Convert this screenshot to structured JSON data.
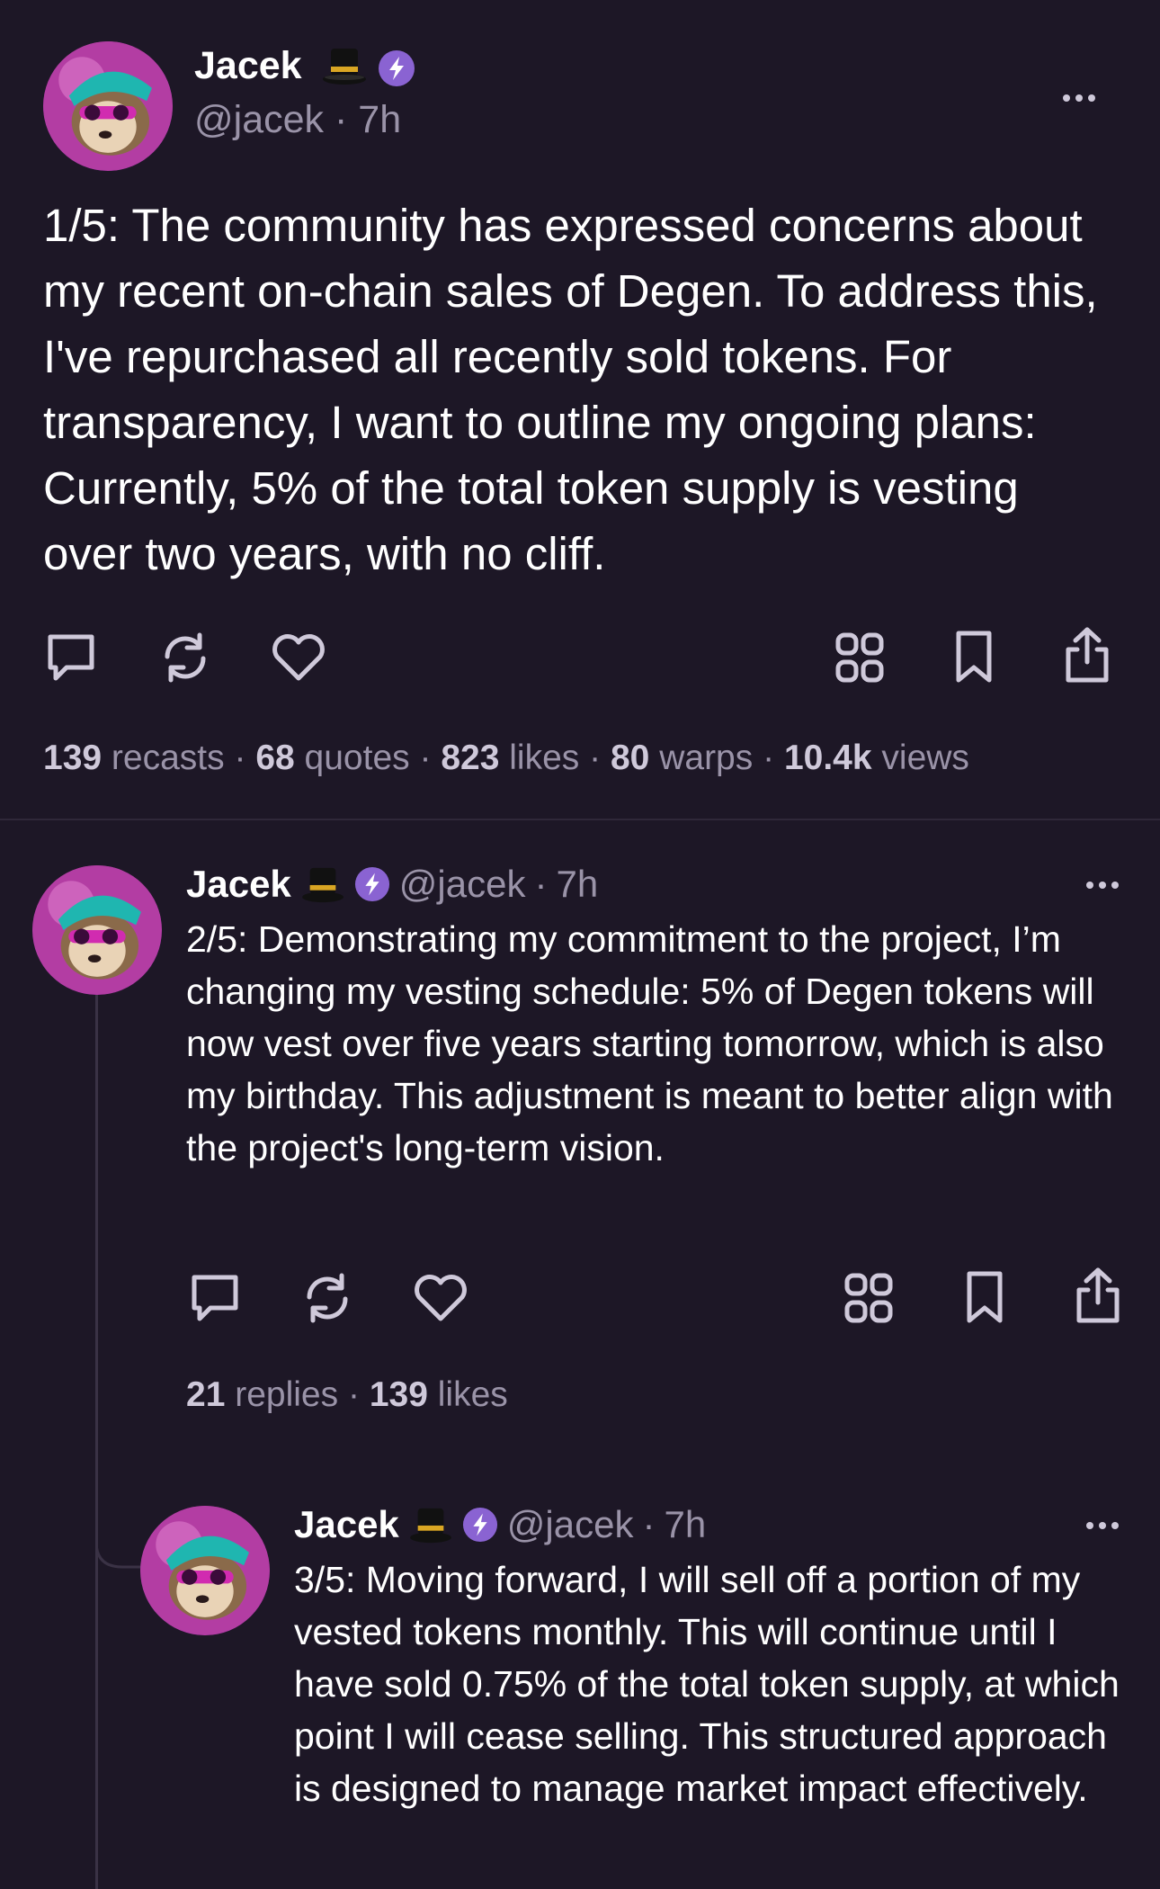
{
  "posts": [
    {
      "display_name": "Jacek",
      "handle": "@jacek",
      "separator": "·",
      "time": "7h",
      "text": "1/5: The community has expressed concerns about my recent on-chain sales of Degen. To address this, I've repurchased all recently sold tokens. For transparency, I want to outline my ongoing plans: Currently, 5% of the total token supply is vesting over two years, with no cliff.",
      "stats": [
        {
          "count": "139",
          "label": "recasts"
        },
        {
          "count": "68",
          "label": "quotes"
        },
        {
          "count": "823",
          "label": "likes"
        },
        {
          "count": "80",
          "label": "warps"
        },
        {
          "count": "10.4k",
          "label": "views"
        }
      ]
    },
    {
      "display_name": "Jacek",
      "handle": "@jacek",
      "separator": "·",
      "time": "7h",
      "text": "2/5: Demonstrating my commitment to the project, I’m changing my vesting schedule: 5% of Degen tokens will now vest over five years starting tomorrow, which is also my birthday. This adjustment is meant to better align with the project's long-term vision.",
      "stats": [
        {
          "count": "21",
          "label": "replies"
        },
        {
          "count": "139",
          "label": "likes"
        }
      ]
    },
    {
      "display_name": "Jacek",
      "handle": "@jacek",
      "separator": "·",
      "time": "7h",
      "text": "3/5: Moving forward, I will sell off a portion of my vested tokens monthly. This will continue until I have sold 0.75% of the total token supply, at which point I will cease selling. This structured approach is designed to manage market impact effectively."
    }
  ],
  "stat_separator": "·",
  "icons": {
    "name_badge": "top-hat-icon",
    "verified": "lightning-badge-icon",
    "reply": "comment-icon",
    "recast": "recast-icon",
    "like": "heart-icon",
    "apps": "grid-icon",
    "bookmark": "bookmark-icon",
    "share": "share-icon",
    "more": "more-dots-icon"
  },
  "colors": {
    "background": "#1d1726",
    "text": "#ffffff",
    "muted": "#9a93a8",
    "badge": "#8a63d2"
  }
}
